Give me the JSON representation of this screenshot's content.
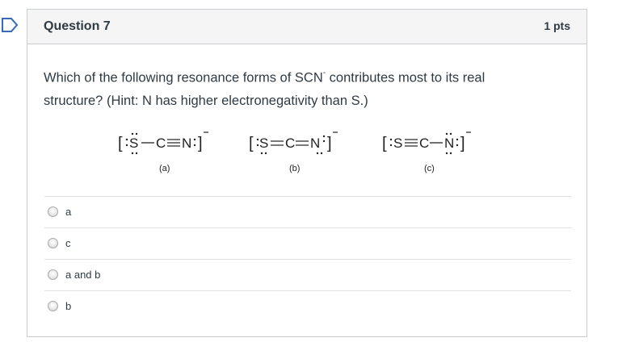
{
  "question": {
    "title": "Question 7",
    "points": "1 pts",
    "text_line1": "Which of the following resonance forms of SCN",
    "superscript": "-",
    "text_line1_rest": " contributes most to its real",
    "text_line2": "structure? (Hint:  N has higher electronegativity than S.)"
  },
  "structures": [
    {
      "label": "(a)",
      "S": "S",
      "C": "C",
      "N": "N"
    },
    {
      "label": "(b)",
      "S": "S",
      "C": "C",
      "N": "N"
    },
    {
      "label": "(c)",
      "S": "S",
      "C": "C",
      "N": "N"
    }
  ],
  "answers": [
    {
      "label": "a"
    },
    {
      "label": "c"
    },
    {
      "label": "a and b"
    },
    {
      "label": "b"
    }
  ],
  "colors": {
    "border": "#c7cdd1",
    "header_bg": "#f5f5f5",
    "flag": "#2d6bcf",
    "text": "#2d3b45"
  }
}
